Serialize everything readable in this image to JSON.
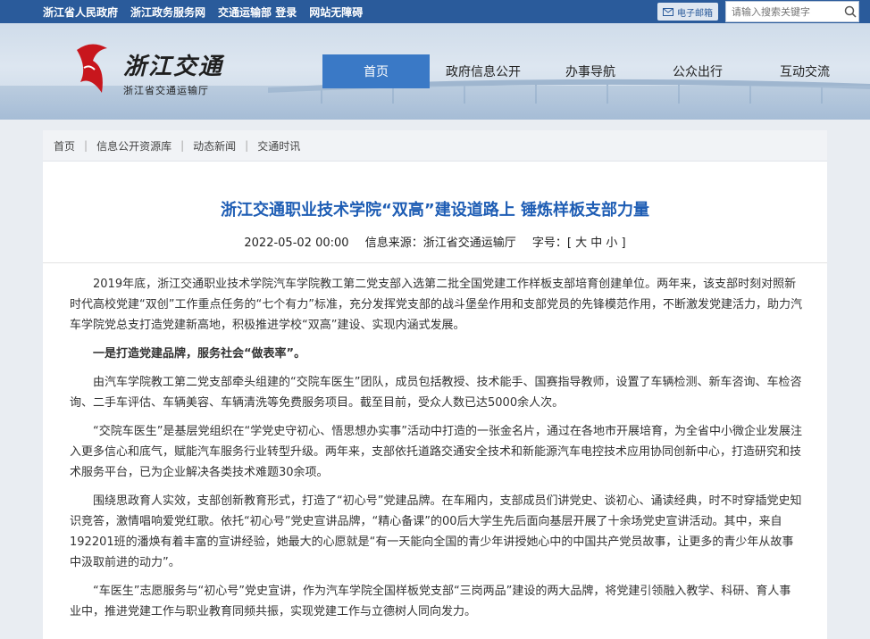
{
  "topbar": {
    "links": [
      "浙江省人民政府",
      "浙江政务服务网",
      "交通运输部 登录",
      "网站无障碍"
    ],
    "mail_label": "电子邮箱",
    "search_placeholder": "请输入搜索关键字"
  },
  "logo": {
    "main": "浙江交通",
    "sub": "浙江省交通运输厅"
  },
  "nav": [
    "首页",
    "政府信息公开",
    "办事导航",
    "公众出行",
    "互动交流"
  ],
  "breadcrumb": [
    "首页",
    "信息公开资源库",
    "动态新闻",
    "交通时讯"
  ],
  "article": {
    "title": "浙江交通职业技术学院“双高”建设道路上 锤炼样板支部力量",
    "date": "2022-05-02 00:00",
    "source": "信息来源：浙江省交通运输厅",
    "size_label": "字号：[",
    "size_big": "大",
    "size_mid": "中",
    "size_small": "小",
    "size_end": "]",
    "paragraphs": [
      "2019年底，浙江交通职业技术学院汽车学院教工第二党支部入选第二批全国党建工作样板支部培育创建单位。两年来，该支部时刻对照新时代高校党建“双创”工作重点任务的“七个有力”标准，充分发挥党支部的战斗堡垒作用和支部党员的先锋模范作用，不断激发党建活力，助力汽车学院党总支打造党建新高地，积极推进学校“双高”建设、实现内涵式发展。",
      "一是打造党建品牌，服务社会“做表率”。",
      "由汽车学院教工第二党支部牵头组建的“交院车医生”团队，成员包括教授、技术能手、国赛指导教师，设置了车辆检测、新车咨询、车检咨询、二手车评估、车辆美容、车辆清洗等免费服务项目。截至目前，受众人数已达5000余人次。",
      "“交院车医生”是基层党组织在“学党史守初心、悟思想办实事”活动中打造的一张金名片，通过在各地市开展培育，为全省中小微企业发展注入更多信心和底气，赋能汽车服务行业转型升级。两年来，支部依托道路交通安全技术和新能源汽车电控技术应用协同创新中心，打造研究和技术服务平台，已为企业解决各类技术难题30余项。",
      "围绕思政育人实效，支部创新教育形式，打造了“初心号”党建品牌。在车厢内，支部成员们讲党史、谈初心、诵读经典，时不时穿插党史知识竞答，激情唱响爱党红歌。依托“初心号”党史宣讲品牌，“精心备课”的00后大学生先后面向基层开展了十余场党史宣讲活动。其中，来自192201班的潘焕有着丰富的宣讲经验，她最大的心愿就是“有一天能向全国的青少年讲授她心中的中国共产党员故事，让更多的青少年从故事中汲取前进的动力”。",
      "“车医生”志愿服务与“初心号”党史宣讲，作为汽车学院全国样板党支部“三岗两品”建设的两大品牌，将党建引领融入教学、科研、育人事业中，推进党建工作与职业教育同频共振，实现党建工作与立德树人同向发力。"
    ]
  }
}
